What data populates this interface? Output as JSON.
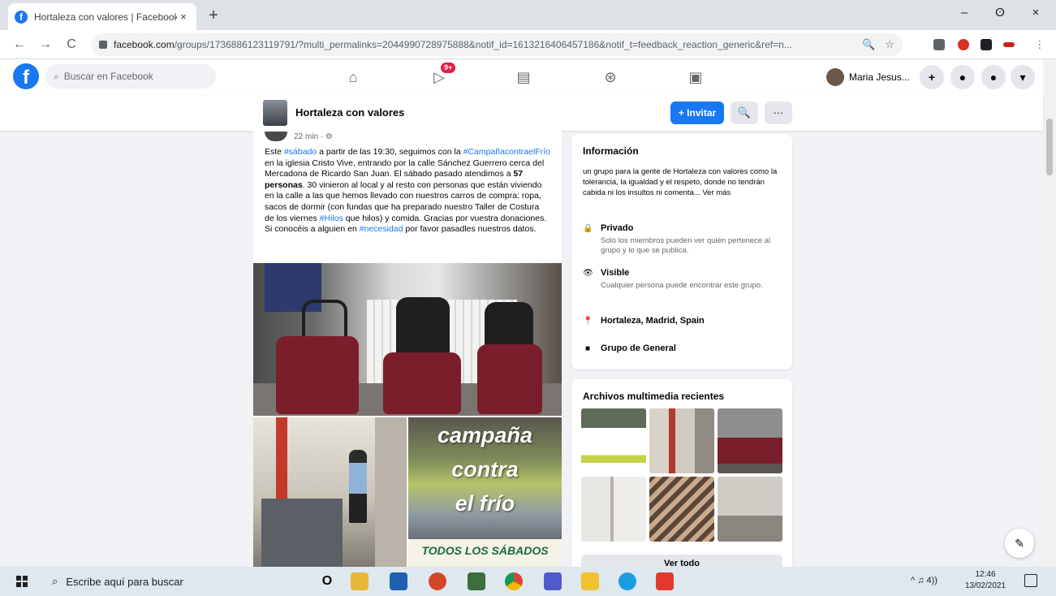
{
  "browser": {
    "tab_title": "Hortaleza con valores | Facebook",
    "tab_close": "×",
    "new_tab": "+",
    "window": {
      "minimize": "–",
      "maximize": "ʘ",
      "close": "×"
    },
    "nav": {
      "back": "←",
      "forward": "→",
      "reload": "C"
    },
    "url_host": "facebook.com",
    "url_path": "/groups/1736886123119791/?multi_permalinks=2044990728975888&notif_id=1613216406457186&notif_t=feedback_reaction_generic&ref=n...",
    "zoom_icon": "🔍",
    "star_icon": "☆"
  },
  "facebook": {
    "logo": "f",
    "search_placeholder": "Buscar en Facebook",
    "nav_badge": "9+",
    "profile_name": "Maria Jesus...",
    "header_btns": {
      "create": "+",
      "messenger": "●",
      "notifications": "●",
      "account": "▾"
    }
  },
  "group": {
    "name": "Hortaleza con valores",
    "invite_label": "+ Invitar",
    "search_icon": "🔍",
    "more_label": "···"
  },
  "post": {
    "meta_time": "22 min · ⚙",
    "text_parts": {
      "p1": "Este ",
      "h1": "#sábado",
      "p2": " a partir de las 19:30, seguimos con la ",
      "h2": "#CampañacontraelFrío",
      "p3": " en la iglesia Cristo Vive, entrando por la calle Sánchez Guerrero cerca del Mercadona de Ricardo San Juan. El sábado pasado atendimos a ",
      "b1": "57 personas",
      "p4": ". 30 vinieron al local y al resto con personas que están viviendo en la calle a las que hemos llevado con nuestros carros de compra: ropa, sacos de dormir (con fundas que ha preparado nuestro Taller de Costura de los viernes ",
      "h3": "#Hilos",
      "p5": " que hilos) y comida. Gracias por vuestra donaciones. Si conocéis a alguien en ",
      "h4": "#necesidad",
      "p6": " por favor pasadles nuestros datos."
    },
    "poster_lines": [
      "campaña",
      "contra",
      "el frío"
    ],
    "poster_band": "TODOS LOS SÁBADOS"
  },
  "info": {
    "title": "Información",
    "description": "un grupo para la gente de Hortaleza con valores como la tolerancia, la igualdad y el respeto, donde no tendrán cabida ni los insultos ni comenta... Ver más",
    "rows": [
      {
        "icon": "🔒",
        "title": "Privado",
        "sub": "Solo los miembros pueden ver quién pertenece al grupo y lo que se publica."
      },
      {
        "icon": "👁",
        "title": "Visible",
        "sub": "Cualquier persona puede encontrar este grupo."
      },
      {
        "icon": "📍",
        "title": "Hortaleza, Madrid, Spain",
        "sub": ""
      },
      {
        "icon": "■",
        "title": "Grupo de General",
        "sub": ""
      }
    ]
  },
  "media": {
    "title": "Archivos multimedia recientes",
    "see_all": "Ver todo"
  },
  "edit_icon": "✎",
  "taskbar": {
    "search_placeholder": "Escribe aquí para buscar",
    "search_icon": "⌕",
    "cortana": "O",
    "tray_text": "^ ♫ 4))",
    "time": "12:46",
    "date": "13/02/2021"
  },
  "colors": {
    "facebook_blue": "#1877f2",
    "badge_red": "#e41e3f",
    "bag_red": "#7b1e2c"
  }
}
